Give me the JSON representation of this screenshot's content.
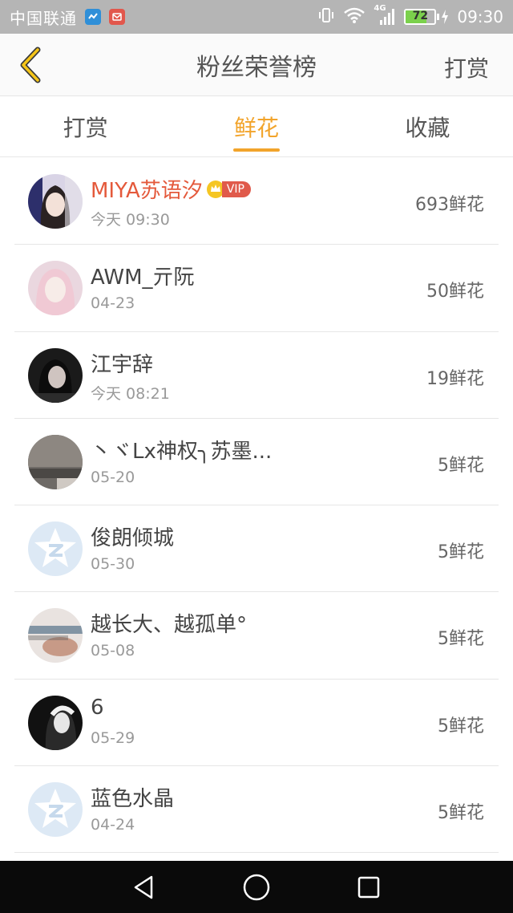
{
  "status_bar": {
    "carrier": "中国联通",
    "network": "4G",
    "battery": "72",
    "battery_level": 0.72,
    "time": "09:30"
  },
  "header": {
    "title": "粉丝荣誉榜",
    "action": "打赏"
  },
  "tabs": [
    {
      "label": "打赏",
      "active": false
    },
    {
      "label": "鲜花",
      "active": true
    },
    {
      "label": "收藏",
      "active": false
    }
  ],
  "fans": [
    {
      "name": "MIYA苏语汐",
      "date": "今天 09:30",
      "amount": "693鲜花",
      "vip": true,
      "vip_label": "VIP",
      "avatar": "photo-girl-dark-hair"
    },
    {
      "name": "AWM_亓阮",
      "date": "04-23",
      "amount": "50鲜花",
      "vip": false,
      "avatar": "photo-girl-pink-hair"
    },
    {
      "name": "江宇辞",
      "date": "今天 08:21",
      "amount": "19鲜花",
      "vip": false,
      "avatar": "photo-dark-portrait"
    },
    {
      "name": "丶ヾLx神权╮苏墨...",
      "date": "05-20",
      "amount": "5鲜花",
      "vip": false,
      "avatar": "photo-text-overlay"
    },
    {
      "name": "俊朗倾城",
      "date": "05-30",
      "amount": "5鲜花",
      "vip": false,
      "avatar": "default-star-avatar"
    },
    {
      "name": "越长大、越孤单°",
      "date": "05-08",
      "amount": "5鲜花",
      "vip": false,
      "avatar": "photo-hands"
    },
    {
      "name": "6",
      "date": "05-29",
      "amount": "5鲜花",
      "vip": false,
      "avatar": "photo-bw-portrait"
    },
    {
      "name": "蓝色水晶",
      "date": "04-24",
      "amount": "5鲜花",
      "vip": false,
      "avatar": "default-star-avatar"
    }
  ],
  "colors": {
    "accent": "#f2a42b",
    "vip_name": "#e4593b",
    "status_bar": "#b5b5b5",
    "nav_bar": "#0a0a0a"
  }
}
